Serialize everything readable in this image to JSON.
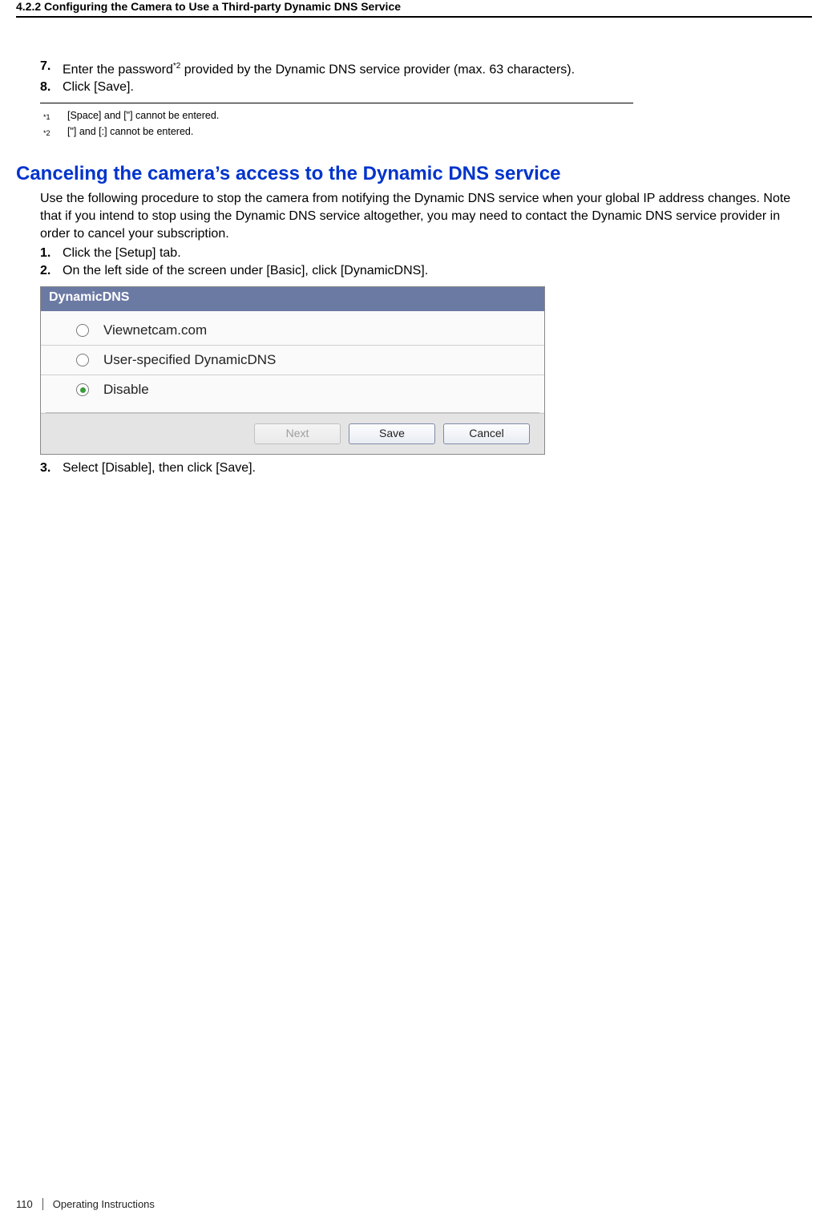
{
  "header": {
    "section_title": "4.2.2 Configuring the Camera to Use a Third-party Dynamic DNS Service"
  },
  "steps_top": [
    {
      "num": "7.",
      "text_pre": "Enter the password",
      "sup": "*2",
      "text_post": " provided by the Dynamic DNS service provider (max. 63 characters)."
    },
    {
      "num": "8.",
      "text_pre": "Click [Save].",
      "sup": "",
      "text_post": ""
    }
  ],
  "footnotes": [
    {
      "num": "*1",
      "text": "[Space] and [\"] cannot be entered."
    },
    {
      "num": "*2",
      "text": "[\"] and [:] cannot be entered."
    }
  ],
  "h2": "Canceling the camera’s access to the Dynamic DNS service",
  "cancel_para": "Use the following procedure to stop the camera from notifying the Dynamic DNS service when your global IP address changes. Note that if you intend to stop using the Dynamic DNS service altogether, you may need to contact the Dynamic DNS service provider in order to cancel your subscription.",
  "cancel_steps_a": [
    {
      "num": "1.",
      "text": "Click the [Setup] tab."
    },
    {
      "num": "2.",
      "text": "On the left side of the screen under [Basic], click [DynamicDNS]."
    }
  ],
  "widget": {
    "title": "DynamicDNS",
    "options": [
      {
        "label": "Viewnetcam.com",
        "selected": false
      },
      {
        "label": "User-specified DynamicDNS",
        "selected": false
      },
      {
        "label": "Disable",
        "selected": true
      }
    ],
    "buttons": {
      "next": "Next",
      "save": "Save",
      "cancel": "Cancel"
    }
  },
  "cancel_steps_b": [
    {
      "num": "3.",
      "text": "Select [Disable], then click [Save]."
    }
  ],
  "footer": {
    "page_number": "110",
    "doc_title": "Operating Instructions"
  }
}
